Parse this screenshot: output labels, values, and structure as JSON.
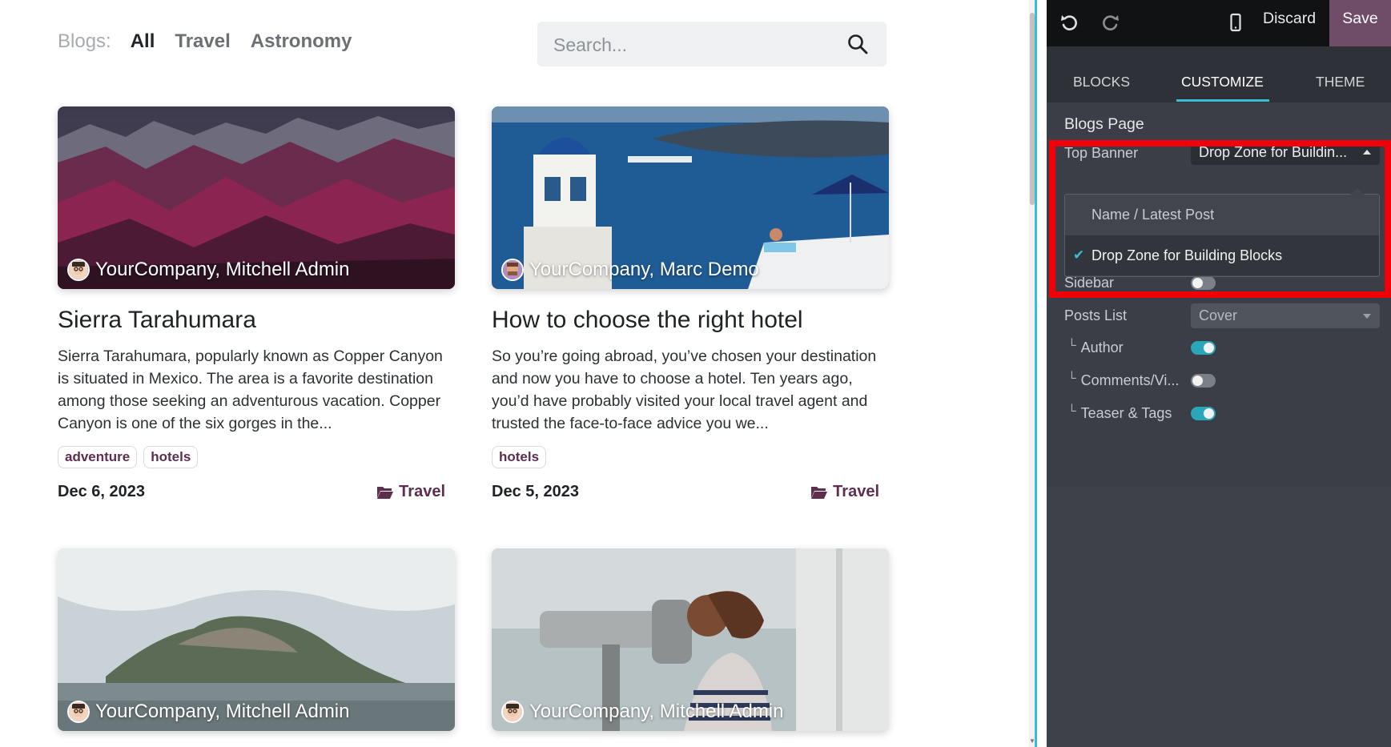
{
  "blog_filters": {
    "label": "Blogs:",
    "tags": [
      "All",
      "Travel",
      "Astronomy"
    ],
    "active": "All"
  },
  "search": {
    "placeholder": "Search..."
  },
  "posts": [
    {
      "author": "YourCompany, Mitchell Admin",
      "title": "Sierra Tarahumara",
      "teaser": "Sierra Tarahumara, popularly known as Copper Canyon is situated in Mexico. The area is a favorite destination among those seeking an adventurous vacation. Copper Canyon is one of the six gorges in the...",
      "tags": [
        "adventure",
        "hotels"
      ],
      "date": "Dec 6, 2023",
      "category": "Travel"
    },
    {
      "author": "YourCompany, Marc Demo",
      "title": "How to choose the right hotel",
      "teaser": "So you’re going abroad, you’ve chosen your destination and now you have to choose a hotel. Ten years ago, you’d have probably visited your local travel agent and trusted the face-to-face advice you we...",
      "tags": [
        "hotels"
      ],
      "date": "Dec 5, 2023",
      "category": "Travel"
    },
    {
      "author": "YourCompany, Mitchell Admin"
    },
    {
      "author": "YourCompany, Mitchell Admin"
    }
  ],
  "editor": {
    "discard_label": "Discard",
    "save_label": "Save",
    "tabs": [
      "BLOCKS",
      "CUSTOMIZE",
      "THEME"
    ],
    "active_tab": "CUSTOMIZE",
    "section_title": "Blogs Page",
    "top_banner": {
      "label": "Top Banner",
      "value": "Drop Zone for Buildin...",
      "options": [
        "Name / Latest Post",
        "Drop Zone for Building Blocks"
      ],
      "selected": "Drop Zone for Building Blocks"
    },
    "sidebar": {
      "label": "Sidebar",
      "on": false
    },
    "posts_list": {
      "label": "Posts List",
      "value": "Cover"
    },
    "author": {
      "label": "Author",
      "on": true
    },
    "comments": {
      "label": "Comments/Vi...",
      "on": false
    },
    "teaser_tags": {
      "label": "Teaser & Tags",
      "on": true
    }
  },
  "colors": {
    "accent": "#38bfd0",
    "brand": "#6f4c68",
    "tag_text": "#5d2e4e",
    "highlight": "#f2000a"
  }
}
